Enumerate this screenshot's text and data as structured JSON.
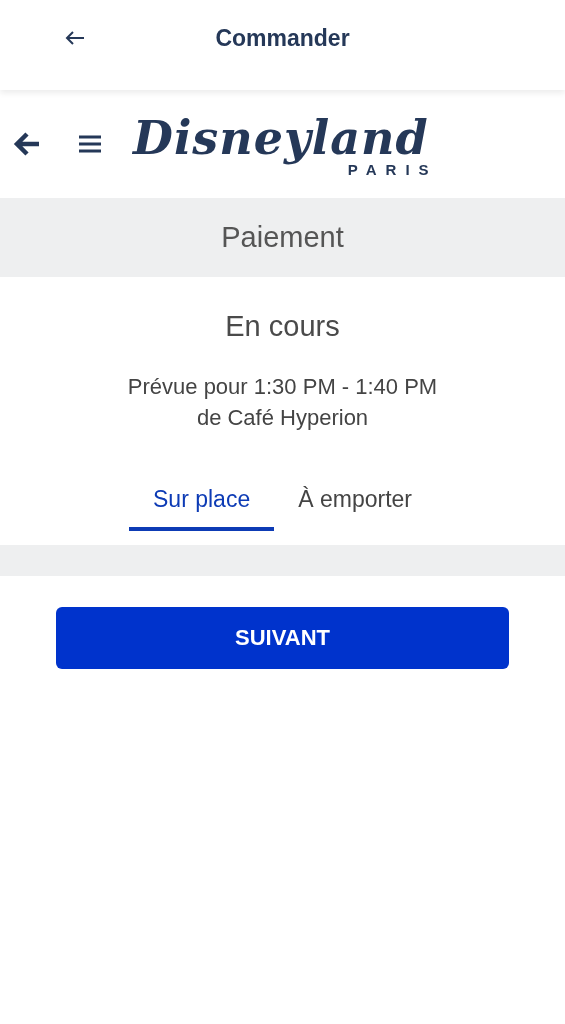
{
  "top_bar": {
    "title": "Commander"
  },
  "header": {
    "logo": {
      "name": "Disneyland",
      "subtitle": "PARIS"
    }
  },
  "section": {
    "title": "Paiement"
  },
  "order": {
    "status": "En cours",
    "time": "Prévue pour 1:30 PM - 1:40 PM",
    "place": "de Café Hyperion"
  },
  "tabs": [
    {
      "label": "Sur place",
      "selected": true
    },
    {
      "label": "À emporter",
      "selected": false
    }
  ],
  "button": {
    "label": "SUIVANT"
  }
}
